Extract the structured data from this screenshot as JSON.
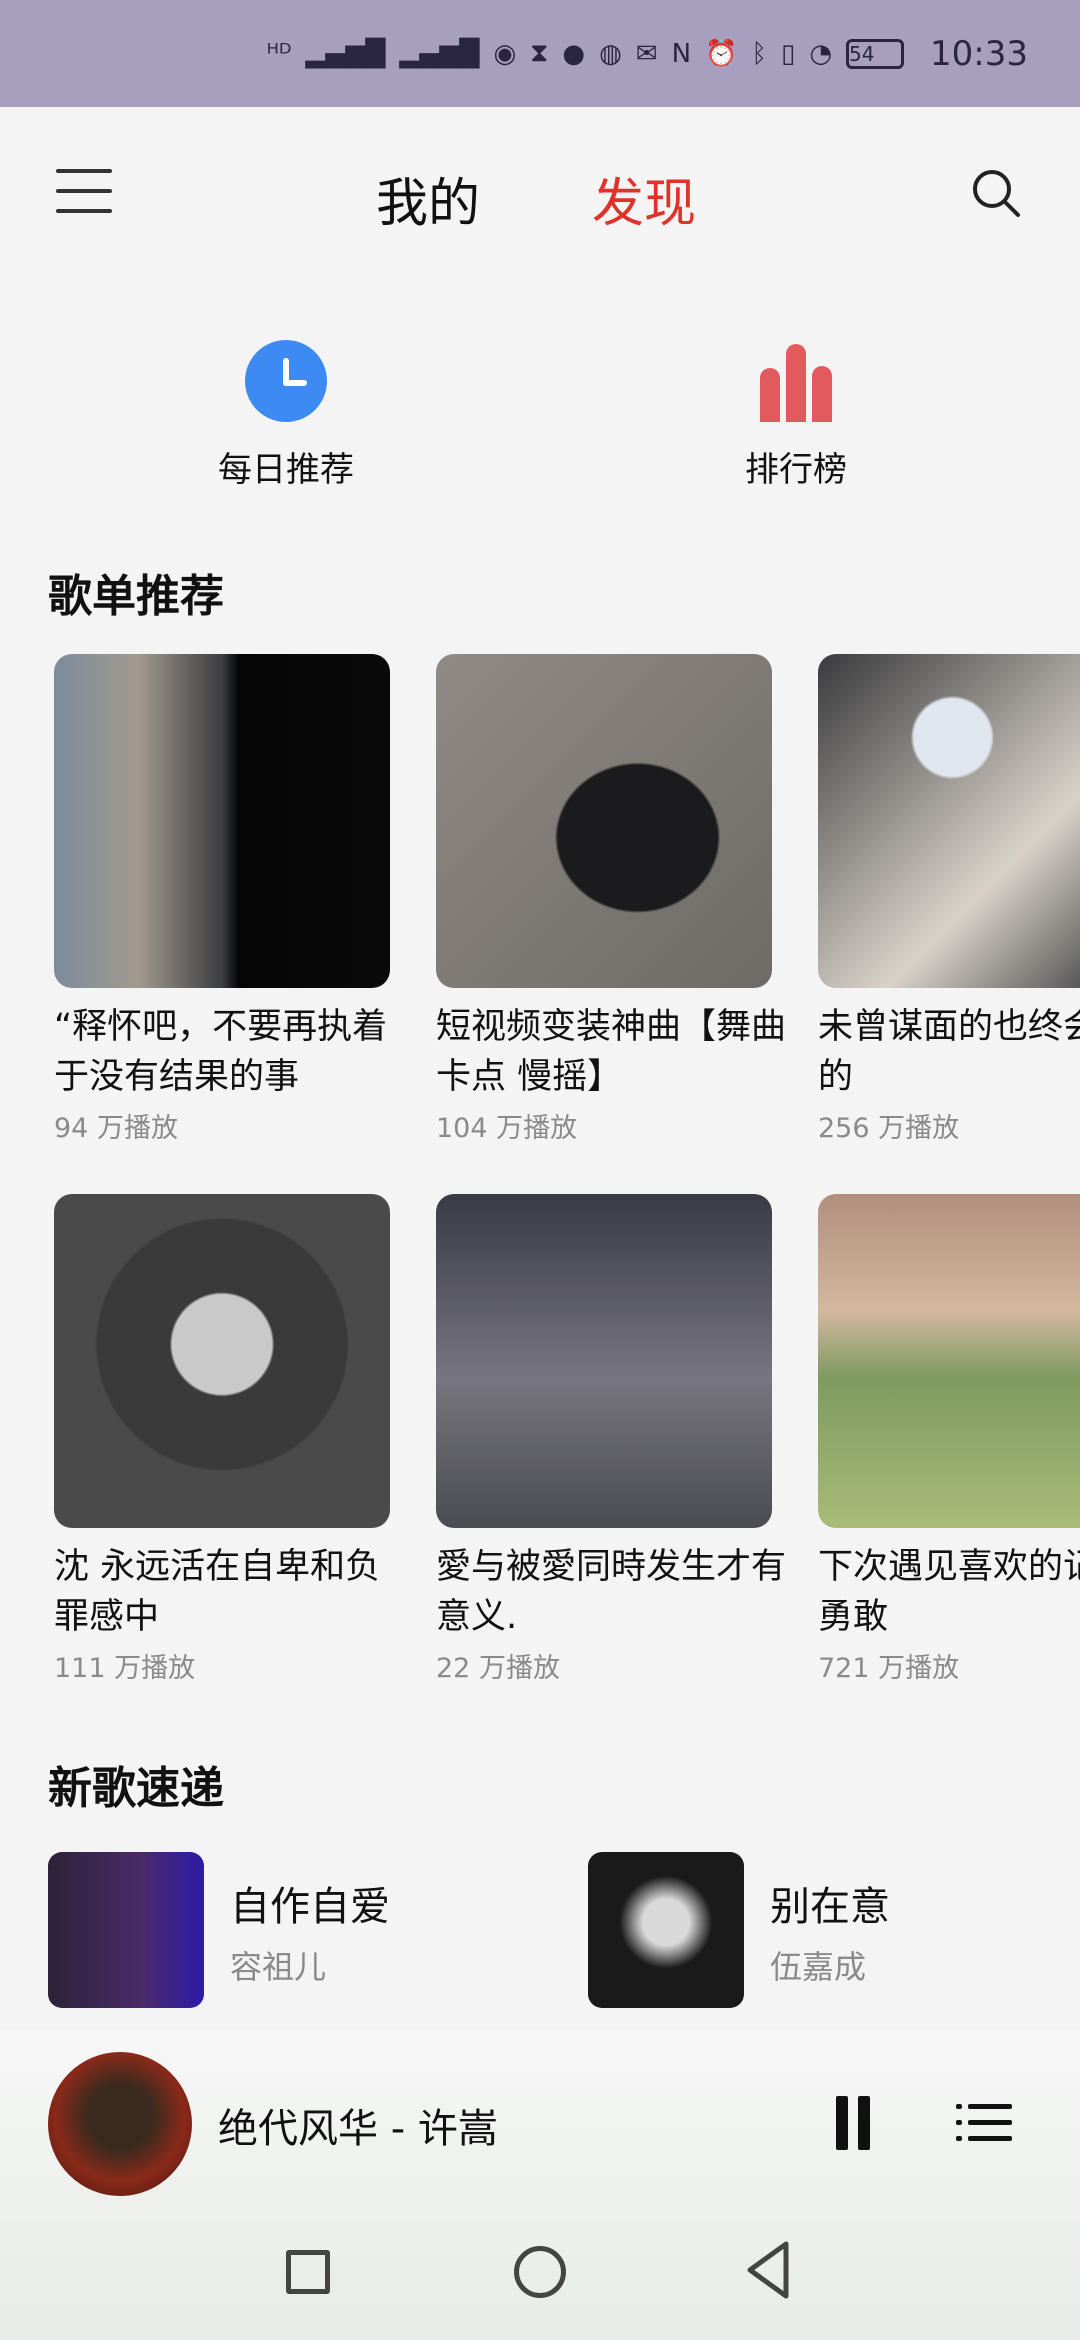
{
  "status_bar": {
    "time": "10:33",
    "battery": "54",
    "icons": [
      "hd-icon",
      "signal-4g-icon",
      "signal-4g-icon",
      "hotspot-icon",
      "data-icon",
      "hourglass-icon",
      "chat-icon",
      "browser-icon",
      "mail-icon",
      "nfc-icon",
      "alarm-icon",
      "bluetooth-icon",
      "vibrate-icon",
      "speed-icon",
      "battery-icon"
    ]
  },
  "header": {
    "tab_mine": "我的",
    "tab_discover": "发现",
    "active_tab_color": "#e0322a"
  },
  "quick_entries": [
    {
      "label": "每日推荐",
      "icon": "clock-icon",
      "color": "#3d8bf2"
    },
    {
      "label": "排行榜",
      "icon": "chart-bars-icon",
      "color": "#e35a5e"
    }
  ],
  "playlist_section": {
    "title": "歌单推荐",
    "row1": [
      {
        "title": "“释怀吧，不要再执着于没有结果的事",
        "plays": "94 万播放"
      },
      {
        "title": "短视频变装神曲【舞曲 卡点 慢摇】",
        "plays": "104 万播放"
      },
      {
        "title": "未曾谋面的也终会相遇的",
        "plays": "256 万播放"
      }
    ],
    "row2": [
      {
        "title": "沈 永远活在自卑和负罪感中",
        "plays": "111 万播放"
      },
      {
        "title": "愛与被愛同時发生才有意义.",
        "plays": "22 万播放"
      },
      {
        "title": "下次遇见喜欢的记得要勇敢",
        "plays": "721 万播放"
      }
    ]
  },
  "new_songs": {
    "title": "新歌速递",
    "items": [
      {
        "title": "自作自爱",
        "artist": "容祖儿"
      },
      {
        "title": "别在意",
        "artist": "伍嘉成"
      }
    ]
  },
  "player": {
    "now_playing": "绝代风华 - 许嵩"
  }
}
